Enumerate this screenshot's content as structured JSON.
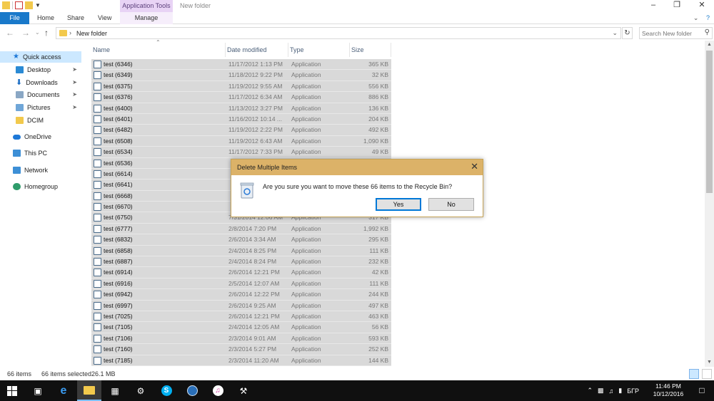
{
  "window": {
    "title": "New folder",
    "context_tab": "Application Tools"
  },
  "ribbon": {
    "tabs": [
      "File",
      "Home",
      "Share",
      "View",
      "Manage"
    ]
  },
  "address": {
    "path": "New folder",
    "search_placeholder": "Search New folder"
  },
  "nav": {
    "items": [
      {
        "label": "Quick access",
        "icon": "star-icon",
        "color": "#1e78d7"
      },
      {
        "label": "Desktop",
        "icon": "desktop-icon",
        "color": "#2a8ad4",
        "pinned": true
      },
      {
        "label": "Downloads",
        "icon": "download-icon",
        "color": "#1c6ec4",
        "pinned": true
      },
      {
        "label": "Documents",
        "icon": "documents-icon",
        "color": "#8aa7c4",
        "pinned": true
      },
      {
        "label": "Pictures",
        "icon": "pictures-icon",
        "color": "#6fa6d8",
        "pinned": true
      },
      {
        "label": "DCIM",
        "icon": "folder-icon",
        "color": "#f2c94c"
      },
      {
        "label": "OneDrive",
        "icon": "cloud-icon",
        "color": "#1e78d7"
      },
      {
        "label": "This PC",
        "icon": "computer-icon",
        "color": "#3d8fd6"
      },
      {
        "label": "Network",
        "icon": "network-icon",
        "color": "#3d8fd6"
      },
      {
        "label": "Homegroup",
        "icon": "homegroup-icon",
        "color": "#2f9c6b"
      }
    ]
  },
  "columns": {
    "name": "Name",
    "date": "Date modified",
    "type": "Type",
    "size": "Size"
  },
  "files": [
    {
      "name": "test (6346)",
      "date": "11/17/2012 1:13 PM",
      "type": "Application",
      "size": "365 KB"
    },
    {
      "name": "test (6349)",
      "date": "11/18/2012 9:22 PM",
      "type": "Application",
      "size": "32 KB"
    },
    {
      "name": "test (6375)",
      "date": "11/19/2012 9:55 AM",
      "type": "Application",
      "size": "556 KB"
    },
    {
      "name": "test (6376)",
      "date": "11/17/2012 6:34 AM",
      "type": "Application",
      "size": "886 KB"
    },
    {
      "name": "test (6400)",
      "date": "11/13/2012 3:27 PM",
      "type": "Application",
      "size": "136 KB"
    },
    {
      "name": "test (6401)",
      "date": "11/16/2012 10:14 ...",
      "type": "Application",
      "size": "204 KB"
    },
    {
      "name": "test (6482)",
      "date": "11/19/2012 2:22 PM",
      "type": "Application",
      "size": "492 KB"
    },
    {
      "name": "test (6508)",
      "date": "11/19/2012 6:43 AM",
      "type": "Application",
      "size": "1,090 KB"
    },
    {
      "name": "test (6534)",
      "date": "11/17/2012 7:33 PM",
      "type": "Application",
      "size": "49 KB"
    },
    {
      "name": "test (6536)",
      "date": "",
      "type": "",
      "size": ""
    },
    {
      "name": "test (6614)",
      "date": "",
      "type": "",
      "size": ""
    },
    {
      "name": "test (6641)",
      "date": "",
      "type": "",
      "size": ""
    },
    {
      "name": "test (6668)",
      "date": "",
      "type": "",
      "size": ""
    },
    {
      "name": "test (6670)",
      "date": "",
      "type": "",
      "size": ""
    },
    {
      "name": "test (6750)",
      "date": "7/31/2014 12:06 AM",
      "type": "Application",
      "size": "317 KB"
    },
    {
      "name": "test (6777)",
      "date": "2/8/2014 7:20 PM",
      "type": "Application",
      "size": "1,992 KB"
    },
    {
      "name": "test (6832)",
      "date": "2/6/2014 3:34 AM",
      "type": "Application",
      "size": "295 KB"
    },
    {
      "name": "test (6858)",
      "date": "2/4/2014 8:25 PM",
      "type": "Application",
      "size": "111 KB"
    },
    {
      "name": "test (6887)",
      "date": "2/4/2014 8:24 PM",
      "type": "Application",
      "size": "232 KB"
    },
    {
      "name": "test (6914)",
      "date": "2/6/2014 12:21 PM",
      "type": "Application",
      "size": "42 KB"
    },
    {
      "name": "test (6916)",
      "date": "2/5/2014 12:07 AM",
      "type": "Application",
      "size": "111 KB"
    },
    {
      "name": "test (6942)",
      "date": "2/6/2014 12:22 PM",
      "type": "Application",
      "size": "244 KB"
    },
    {
      "name": "test (6997)",
      "date": "2/6/2014 9:25 AM",
      "type": "Application",
      "size": "497 KB"
    },
    {
      "name": "test (7025)",
      "date": "2/6/2014 12:21 PM",
      "type": "Application",
      "size": "463 KB"
    },
    {
      "name": "test (7105)",
      "date": "2/4/2014 12:05 AM",
      "type": "Application",
      "size": "56 KB"
    },
    {
      "name": "test (7106)",
      "date": "2/3/2014 9:01 AM",
      "type": "Application",
      "size": "593 KB"
    },
    {
      "name": "test (7160)",
      "date": "2/3/2014 5:27 PM",
      "type": "Application",
      "size": "252 KB"
    },
    {
      "name": "test (7185)",
      "date": "2/3/2014 11:20 AM",
      "type": "Application",
      "size": "144 KB"
    }
  ],
  "status": {
    "count": "66 items",
    "selected": "66 items selected",
    "size": "26.1 MB"
  },
  "dialog": {
    "title": "Delete Multiple Items",
    "message": "Are you sure you want to move these 66 items to the Recycle Bin?",
    "yes": "Yes",
    "no": "No",
    "accent": "#dcb268"
  },
  "taskbar": {
    "clock_time": "11:46 PM",
    "clock_date": "10/12/2016",
    "language": "БГР"
  }
}
